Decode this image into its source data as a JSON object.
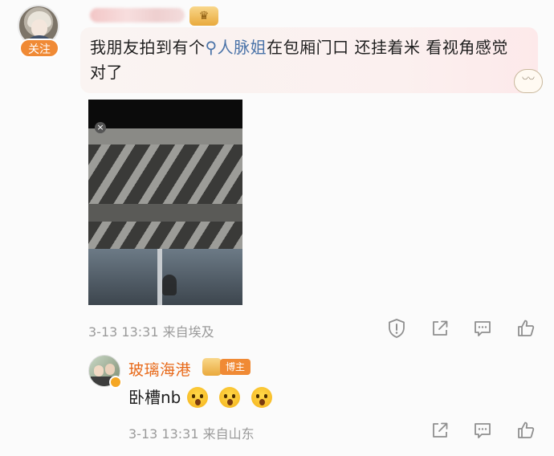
{
  "main_comment": {
    "follow_label": "关注",
    "text_before": "我朋友拍到有个",
    "topic": "人脉姐",
    "text_after": "在包厢门口 还挂着米 看视角感觉对了",
    "time": "3-13 13:31",
    "source": "来自埃及"
  },
  "reply": {
    "username": "玻璃海港",
    "author_tag": "博主",
    "text": "卧槽nb",
    "time": "3-13 13:31",
    "source": "来自山东"
  },
  "icons": {
    "report": "report-icon",
    "share": "share-icon",
    "comment": "comment-icon",
    "like": "like-icon"
  },
  "colors": {
    "follow_button": "#f08a35",
    "topic": "#4a73a8",
    "reply_name": "#e86a1a",
    "meta": "#9a9a9a"
  }
}
